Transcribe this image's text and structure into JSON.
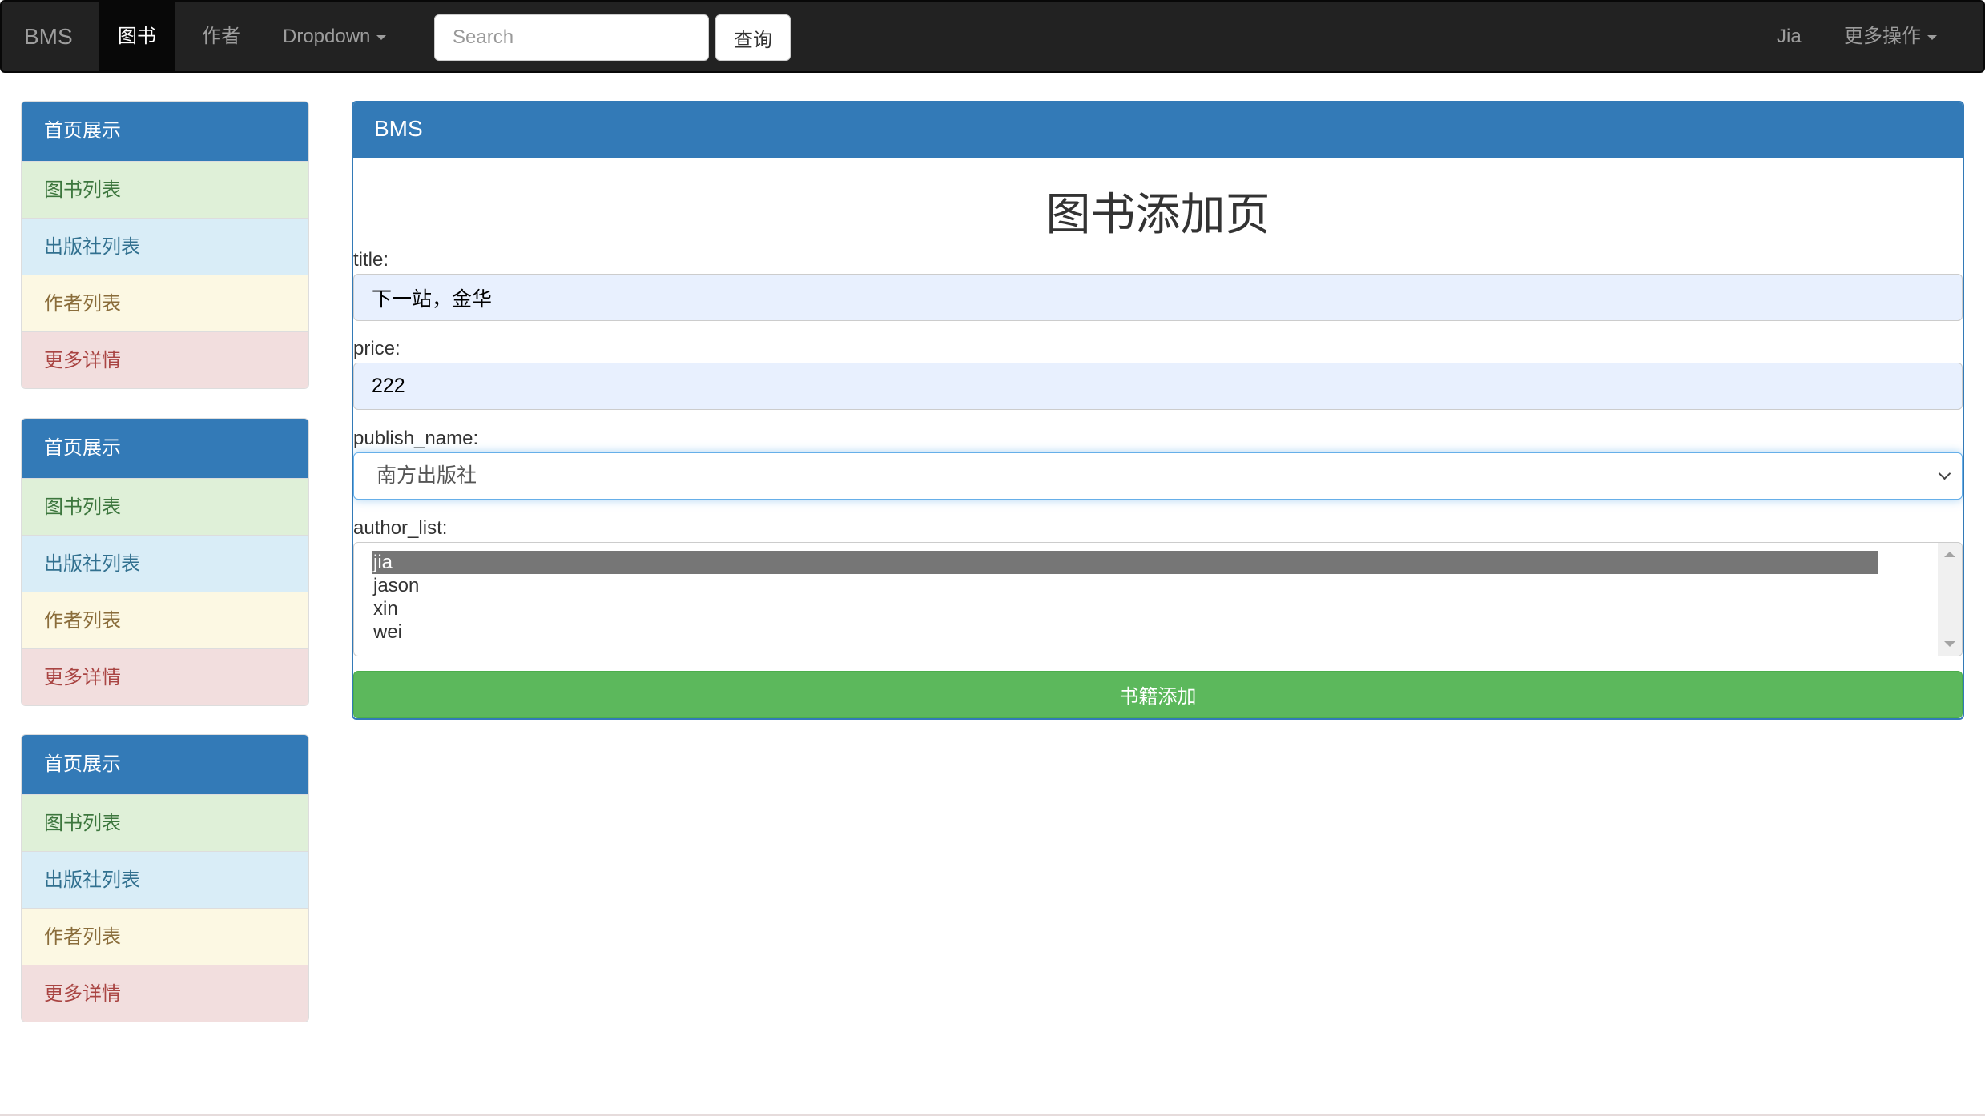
{
  "navbar": {
    "brand": "BMS",
    "items": [
      {
        "label": "图书",
        "active": true
      },
      {
        "label": "作者",
        "active": false
      },
      {
        "label": "Dropdown",
        "active": false
      }
    ],
    "search": {
      "placeholder": "Search",
      "value": ""
    },
    "search_button": "查询",
    "user": "Jia",
    "more_menu": "更多操作"
  },
  "sidebar": {
    "panels": [
      {
        "header": "首页展示",
        "items": [
          "图书列表",
          "出版社列表",
          "作者列表",
          "更多详情"
        ]
      },
      {
        "header": "首页展示",
        "items": [
          "图书列表",
          "出版社列表",
          "作者列表",
          "更多详情"
        ]
      },
      {
        "header": "首页展示",
        "items": [
          "图书列表",
          "出版社列表",
          "作者列表",
          "更多详情"
        ]
      }
    ]
  },
  "main": {
    "panel_title": "BMS",
    "page_title": "图书添加页",
    "form": {
      "title": {
        "label": "title:",
        "value": "下一站，金华"
      },
      "price": {
        "label": "price:",
        "value": "222"
      },
      "publish_name": {
        "label": "publish_name:",
        "selected": "南方出版社"
      },
      "author_list": {
        "label": "author_list:",
        "options": [
          "jia",
          "jason",
          "xin",
          "wei"
        ],
        "selected": [
          "jia"
        ]
      },
      "submit_label": "书籍添加"
    }
  },
  "colors": {
    "navbar_bg": "#222222",
    "primary": "#337ab7",
    "success_button": "#5cb85c",
    "list_success": "#dff0d8",
    "list_info": "#d9edf7",
    "list_warning": "#fcf8e3",
    "list_danger": "#f2dede"
  }
}
